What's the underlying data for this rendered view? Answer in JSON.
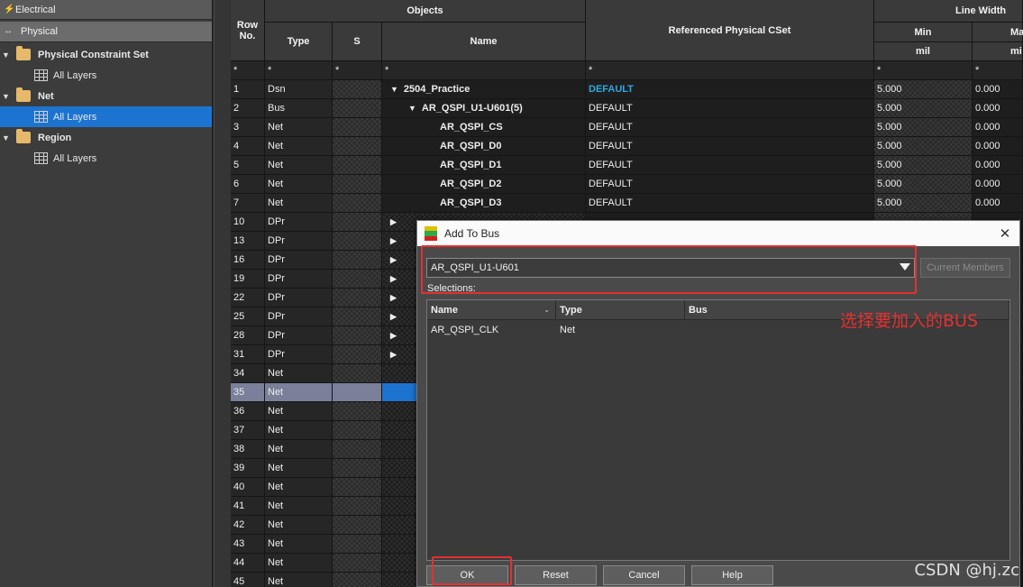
{
  "left_panel": {
    "tabs": [
      "Electrical",
      "Physical"
    ],
    "tree": [
      {
        "label": "Physical Constraint Set",
        "child": "All Layers",
        "selected": false
      },
      {
        "label": "Net",
        "child": "All Layers",
        "selected": true
      },
      {
        "label": "Region",
        "child": "All Layers",
        "selected": false
      }
    ]
  },
  "sheet": {
    "headers": {
      "row_no": "Row No.",
      "objects": "Objects",
      "type": "Type",
      "s": "S",
      "name": "Name",
      "ref_cset": "Referenced Physical CSet",
      "line_width": "Line Width",
      "min": "Min",
      "max": "Ma",
      "unit_min": "mil",
      "unit_max": "mi",
      "filter": "*"
    },
    "rows": [
      {
        "no": "1",
        "type": "Dsn",
        "name": "2504_Practice",
        "indent": 0,
        "expander": "▼",
        "ref": "DEFAULT",
        "ref_hi": true,
        "min": "5.000",
        "max": "0.000"
      },
      {
        "no": "2",
        "type": "Bus",
        "name": "AR_QSPI_U1-U601(5)",
        "indent": 1,
        "expander": "▼",
        "ref": "DEFAULT",
        "ref_hi": false,
        "min": "5.000",
        "max": "0.000"
      },
      {
        "no": "3",
        "type": "Net",
        "name": "AR_QSPI_CS",
        "indent": 2,
        "expander": "",
        "ref": "DEFAULT",
        "ref_hi": false,
        "min": "5.000",
        "max": "0.000"
      },
      {
        "no": "4",
        "type": "Net",
        "name": "AR_QSPI_D0",
        "indent": 2,
        "expander": "",
        "ref": "DEFAULT",
        "ref_hi": false,
        "min": "5.000",
        "max": "0.000"
      },
      {
        "no": "5",
        "type": "Net",
        "name": "AR_QSPI_D1",
        "indent": 2,
        "expander": "",
        "ref": "DEFAULT",
        "ref_hi": false,
        "min": "5.000",
        "max": "0.000"
      },
      {
        "no": "6",
        "type": "Net",
        "name": "AR_QSPI_D2",
        "indent": 2,
        "expander": "",
        "ref": "DEFAULT",
        "ref_hi": false,
        "min": "5.000",
        "max": "0.000"
      },
      {
        "no": "7",
        "type": "Net",
        "name": "AR_QSPI_D3",
        "indent": 2,
        "expander": "",
        "ref": "DEFAULT",
        "ref_hi": false,
        "min": "5.000",
        "max": "0.000"
      },
      {
        "no": "10",
        "type": "DPr",
        "name": "",
        "indent": 0,
        "expander": "▶",
        "ref": "",
        "ref_hi": false,
        "min": "",
        "max": ""
      },
      {
        "no": "13",
        "type": "DPr",
        "name": "",
        "indent": 0,
        "expander": "▶",
        "ref": "",
        "ref_hi": false,
        "min": "",
        "max": ""
      },
      {
        "no": "16",
        "type": "DPr",
        "name": "",
        "indent": 0,
        "expander": "▶",
        "ref": "",
        "ref_hi": false,
        "min": "",
        "max": ""
      },
      {
        "no": "19",
        "type": "DPr",
        "name": "",
        "indent": 0,
        "expander": "▶",
        "ref": "",
        "ref_hi": false,
        "min": "",
        "max": ""
      },
      {
        "no": "22",
        "type": "DPr",
        "name": "",
        "indent": 0,
        "expander": "▶",
        "ref": "",
        "ref_hi": false,
        "min": "",
        "max": ""
      },
      {
        "no": "25",
        "type": "DPr",
        "name": "",
        "indent": 0,
        "expander": "▶",
        "ref": "",
        "ref_hi": false,
        "min": "",
        "max": ""
      },
      {
        "no": "28",
        "type": "DPr",
        "name": "",
        "indent": 0,
        "expander": "▶",
        "ref": "",
        "ref_hi": false,
        "min": "",
        "max": ""
      },
      {
        "no": "31",
        "type": "DPr",
        "name": "",
        "indent": 0,
        "expander": "▶",
        "ref": "",
        "ref_hi": false,
        "min": "",
        "max": ""
      },
      {
        "no": "34",
        "type": "Net",
        "name": "",
        "indent": 0,
        "expander": "",
        "ref": "",
        "ref_hi": false,
        "min": "",
        "max": ""
      },
      {
        "no": "35",
        "type": "Net",
        "name": "",
        "indent": 0,
        "expander": "",
        "ref": "",
        "ref_hi": false,
        "min": "",
        "max": "",
        "selected": true
      },
      {
        "no": "36",
        "type": "Net",
        "name": "",
        "indent": 0,
        "expander": "",
        "ref": "",
        "ref_hi": false,
        "min": "",
        "max": ""
      },
      {
        "no": "37",
        "type": "Net",
        "name": "",
        "indent": 0,
        "expander": "",
        "ref": "",
        "ref_hi": false,
        "min": "",
        "max": ""
      },
      {
        "no": "38",
        "type": "Net",
        "name": "",
        "indent": 0,
        "expander": "",
        "ref": "",
        "ref_hi": false,
        "min": "",
        "max": ""
      },
      {
        "no": "39",
        "type": "Net",
        "name": "",
        "indent": 0,
        "expander": "",
        "ref": "",
        "ref_hi": false,
        "min": "",
        "max": ""
      },
      {
        "no": "40",
        "type": "Net",
        "name": "",
        "indent": 0,
        "expander": "",
        "ref": "",
        "ref_hi": false,
        "min": "",
        "max": ""
      },
      {
        "no": "41",
        "type": "Net",
        "name": "",
        "indent": 0,
        "expander": "",
        "ref": "",
        "ref_hi": false,
        "min": "",
        "max": ""
      },
      {
        "no": "42",
        "type": "Net",
        "name": "",
        "indent": 0,
        "expander": "",
        "ref": "",
        "ref_hi": false,
        "min": "",
        "max": ""
      },
      {
        "no": "43",
        "type": "Net",
        "name": "",
        "indent": 0,
        "expander": "",
        "ref": "",
        "ref_hi": false,
        "min": "",
        "max": ""
      },
      {
        "no": "44",
        "type": "Net",
        "name": "",
        "indent": 0,
        "expander": "",
        "ref": "",
        "ref_hi": false,
        "min": "",
        "max": ""
      },
      {
        "no": "45",
        "type": "Net",
        "name": "",
        "indent": 0,
        "expander": "",
        "ref": "",
        "ref_hi": false,
        "min": "",
        "max": ""
      }
    ]
  },
  "dialog": {
    "title": "Add To Bus",
    "bus_select_value": "AR_QSPI_U1-U601",
    "current_members_label": "Current Members",
    "selections_label": "Selections:",
    "columns": {
      "name": "Name",
      "type": "Type",
      "bus": "Bus"
    },
    "items": [
      {
        "name": "AR_QSPI_CLK",
        "type": "Net",
        "bus": ""
      }
    ],
    "buttons": {
      "ok": "OK",
      "reset": "Reset",
      "cancel": "Cancel",
      "help": "Help"
    }
  },
  "annotation": {
    "text": "选择要加入的BUS",
    "color": "#e53030"
  },
  "watermark": "CSDN @hj.zc"
}
